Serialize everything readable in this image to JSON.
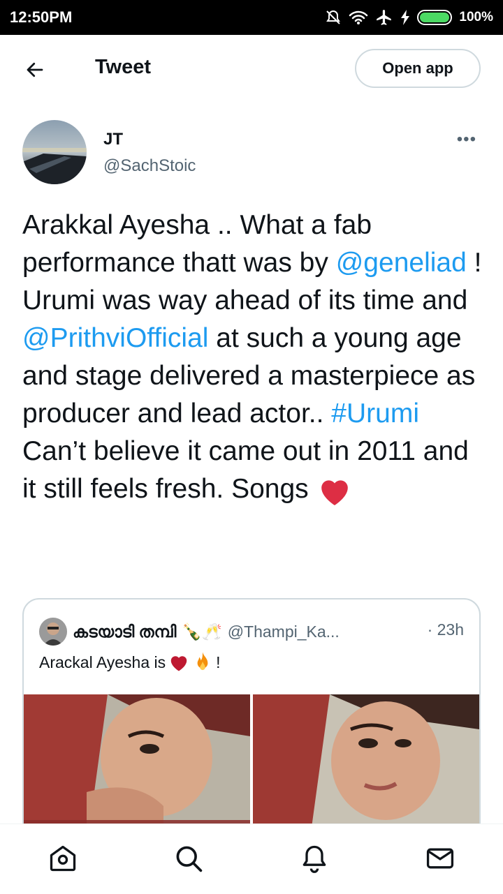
{
  "status_bar": {
    "time": "12:50PM",
    "battery": "100%"
  },
  "header": {
    "title": "Tweet",
    "open_app_label": "Open app"
  },
  "author": {
    "name": "JT",
    "handle": "@SachStoic",
    "more": "•••"
  },
  "tweet": {
    "t1": "Arakkal Ayesha .. What a fab performance thatt was by ",
    "mention1": "@geneliad",
    "t2": " ! Urumi was way ahead of its time and ",
    "mention2": "@PrithviOfficial",
    "t3": " at such a young age and stage delivered a masterpiece as producer and lead actor.. ",
    "hashtag": "#Urumi",
    "t4": " Can’t believe it came out in 2011 and it still feels fresh. Songs "
  },
  "quoted_tweet": {
    "name": "കടയാടി തമ്പി",
    "name_emojis": "🍾🥂",
    "handle": "@Thampi_Ka...",
    "time": "· 23h",
    "text": "Arackal Ayesha is",
    "text_end": "!"
  },
  "icons": {
    "back": "arrow-left-icon",
    "home": "home-icon",
    "search": "search-icon",
    "notifications": "bell-icon",
    "messages": "mail-icon"
  },
  "colors": {
    "link": "#1d9bf0",
    "text": "#0f1419",
    "secondary": "#536471",
    "heart": "#e0245e"
  }
}
